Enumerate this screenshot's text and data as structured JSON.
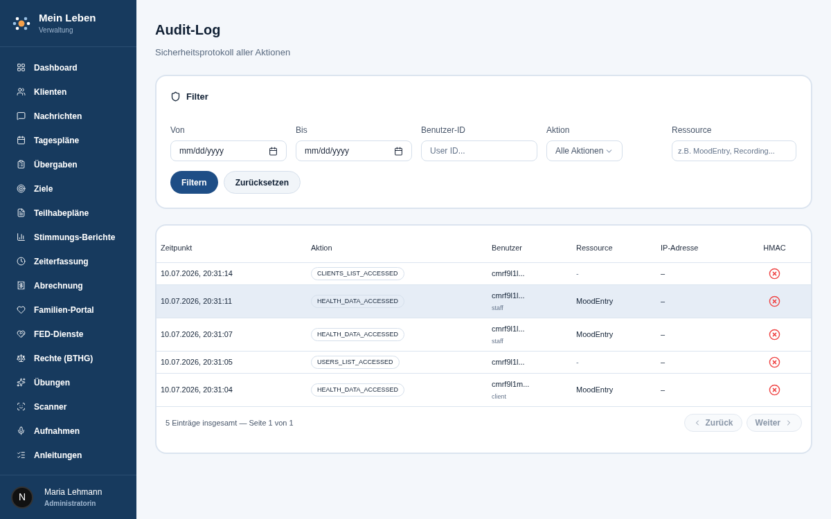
{
  "brand": {
    "title": "Mein Leben",
    "subtitle": "Verwaltung"
  },
  "sidebar": {
    "items": [
      {
        "label": "Dashboard",
        "selected": false
      },
      {
        "label": "Klienten",
        "selected": false
      },
      {
        "label": "Nachrichten",
        "selected": false
      },
      {
        "label": "Tagespläne",
        "selected": false
      },
      {
        "label": "Übergaben",
        "selected": false
      },
      {
        "label": "Ziele",
        "selected": false
      },
      {
        "label": "Teilhabepläne",
        "selected": false
      },
      {
        "label": "Stimmungs-Berichte",
        "selected": false
      },
      {
        "label": "Zeiterfassung",
        "selected": false
      },
      {
        "label": "Abrechnung",
        "selected": false
      },
      {
        "label": "Familien-Portal",
        "selected": false
      },
      {
        "label": "FED-Dienste",
        "selected": false
      },
      {
        "label": "Rechte (BTHG)",
        "selected": false
      },
      {
        "label": "Übungen",
        "selected": false
      },
      {
        "label": "Scanner",
        "selected": false
      },
      {
        "label": "Aufnahmen",
        "selected": false
      },
      {
        "label": "Anleitungen",
        "selected": false
      }
    ]
  },
  "user": {
    "initial": "N",
    "name": "Maria Lehmann",
    "role": "Administratorin"
  },
  "page": {
    "title": "Audit-Log",
    "subtitle": "Sicherheitsprotokoll aller Aktionen"
  },
  "filter": {
    "title": "Filter",
    "fields": [
      {
        "kind": "date",
        "label": "Von",
        "placeholder": "mm/dd/yyyy"
      },
      {
        "kind": "date",
        "label": "Bis",
        "placeholder": "mm/dd/yyyy"
      },
      {
        "kind": "text",
        "label": "Benutzer-ID",
        "placeholder": "User ID..."
      },
      {
        "kind": "select",
        "label": "Aktion",
        "value": "Alle Aktionen"
      },
      {
        "kind": "text",
        "label": "Ressource",
        "placeholder": "z.B. MoodEntry, Recording..."
      }
    ],
    "buttons": [
      {
        "label": "Filtern",
        "kind": "primary"
      },
      {
        "label": "Zurücksetzen",
        "kind": "secondary"
      }
    ]
  },
  "table": {
    "columns": [
      "Zeitpunkt",
      "Aktion",
      "Benutzer",
      "Ressource",
      "IP-Adresse",
      "HMAC"
    ],
    "rows": [
      {
        "time": "10.07.2026, 20:31:14",
        "action": "CLIENTS_LIST_ACCESSED",
        "user": "cmrf9l1l...",
        "resource": "-",
        "ip": "–",
        "hmac_valid": false,
        "selected": false
      },
      {
        "time": "10.07.2026, 20:31:11",
        "action": "HEALTH_DATA_ACCESSED",
        "user": "cmrf9l1l...",
        "role": "staff",
        "resource": "MoodEntry",
        "ip": "–",
        "hmac_valid": false,
        "selected": true
      },
      {
        "time": "10.07.2026, 20:31:07",
        "action": "HEALTH_DATA_ACCESSED",
        "user": "cmrf9l1l...",
        "role": "staff",
        "resource": "MoodEntry",
        "ip": "–",
        "hmac_valid": false,
        "selected": false
      },
      {
        "time": "10.07.2026, 20:31:05",
        "action": "USERS_LIST_ACCESSED",
        "user": "cmrf9l1l...",
        "resource": "-",
        "ip": "–",
        "hmac_valid": false,
        "selected": false
      },
      {
        "time": "10.07.2026, 20:31:04",
        "action": "HEALTH_DATA_ACCESSED",
        "user": "cmrf9l1m...",
        "role": "client",
        "resource": "MoodEntry",
        "ip": "–",
        "hmac_valid": false,
        "selected": false
      }
    ],
    "summary": "5 Einträge insgesamt — Seite 1 von 1",
    "pagination": [
      {
        "label": "Zurück",
        "kind": "prev",
        "disabled": true
      },
      {
        "label": "Weiter",
        "kind": "next",
        "disabled": true
      }
    ]
  }
}
